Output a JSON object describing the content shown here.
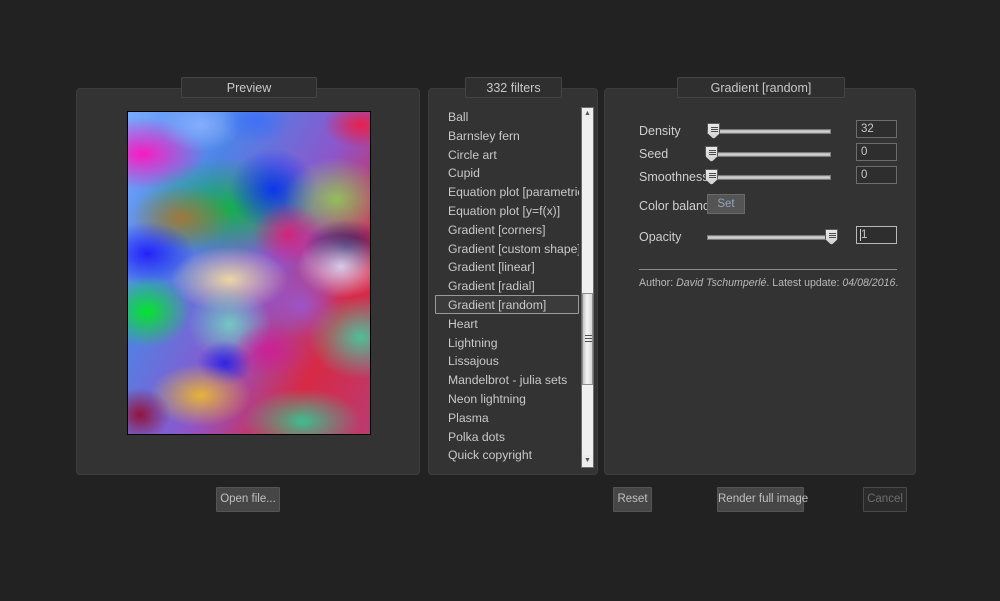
{
  "window": {
    "background_color": "#222222",
    "panel_color": "#333333"
  },
  "preview": {
    "tab_label": "Preview",
    "open_file_label": "Open file...",
    "image_alt": "gradient-random-preview"
  },
  "filters": {
    "tab_label": "332 filters",
    "count": 332,
    "selected": "Gradient [random]",
    "items": [
      {
        "label": "Ball"
      },
      {
        "label": "Barnsley fern"
      },
      {
        "label": "Circle art"
      },
      {
        "label": "Cupid"
      },
      {
        "label": "Equation plot [parametric]"
      },
      {
        "label": "Equation plot [y=f(x)]"
      },
      {
        "label": "Gradient [corners]"
      },
      {
        "label": "Gradient [custom shape]"
      },
      {
        "label": "Gradient [linear]"
      },
      {
        "label": "Gradient [radial]"
      },
      {
        "label": "Gradient [random]"
      },
      {
        "label": "Heart"
      },
      {
        "label": "Lightning"
      },
      {
        "label": "Lissajous"
      },
      {
        "label": "Mandelbrot - julia sets"
      },
      {
        "label": "Neon lightning"
      },
      {
        "label": "Plasma"
      },
      {
        "label": "Polka dots"
      },
      {
        "label": "Quick copyright"
      }
    ],
    "scrollbar": {
      "up_glyph": "▲",
      "down_glyph": "▼"
    }
  },
  "params": {
    "tab_label": "Gradient [random]",
    "rows": [
      {
        "label": "Density",
        "value": "32",
        "handle_pct": 3
      },
      {
        "label": "Seed",
        "value": "0",
        "handle_pct": 0
      },
      {
        "label": "Smoothness",
        "value": "0",
        "handle_pct": 0
      }
    ],
    "color_balance": {
      "label": "Color balance",
      "button_label": "Set"
    },
    "opacity": {
      "label": "Opacity",
      "value": "1",
      "handle_pct": 100
    },
    "author_prefix": "Author: ",
    "author_name": "David Tschumperlé",
    "author_mid": ". Latest update: ",
    "author_date": "04/08/2016",
    "author_suffix": "."
  },
  "buttons": {
    "reset": "Reset",
    "render_full_image": "Render full image",
    "cancel": "Cancel"
  }
}
